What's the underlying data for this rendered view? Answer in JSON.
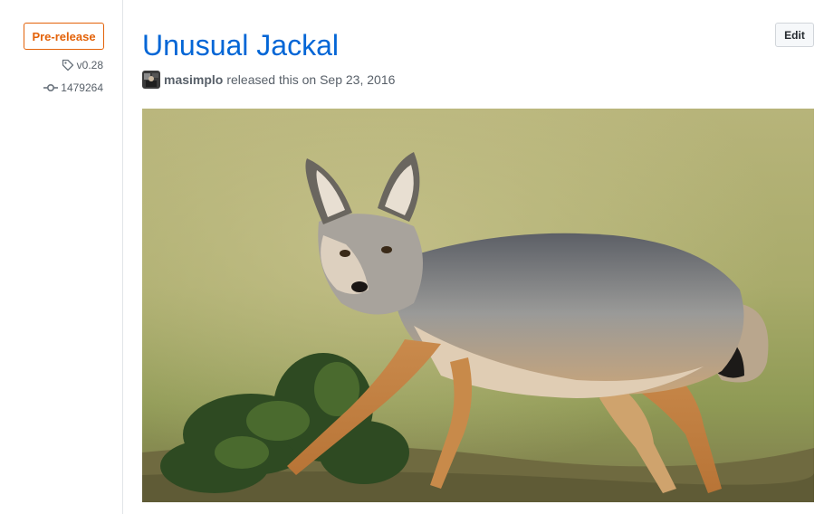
{
  "sidebar": {
    "badge_label": "Pre-release",
    "tag": {
      "label": "v0.28",
      "icon": "tag-icon"
    },
    "commit": {
      "label": "1479264",
      "icon": "commit-icon"
    }
  },
  "release": {
    "title": "Unusual Jackal",
    "edit_label": "Edit",
    "author": "masimplo",
    "byline_text": "released this on Sep 23, 2016",
    "image_subject": "black-backed jackal photo"
  },
  "colors": {
    "accent_link": "#0366d6",
    "prerelease": "#e36209",
    "muted_text": "#586069"
  }
}
